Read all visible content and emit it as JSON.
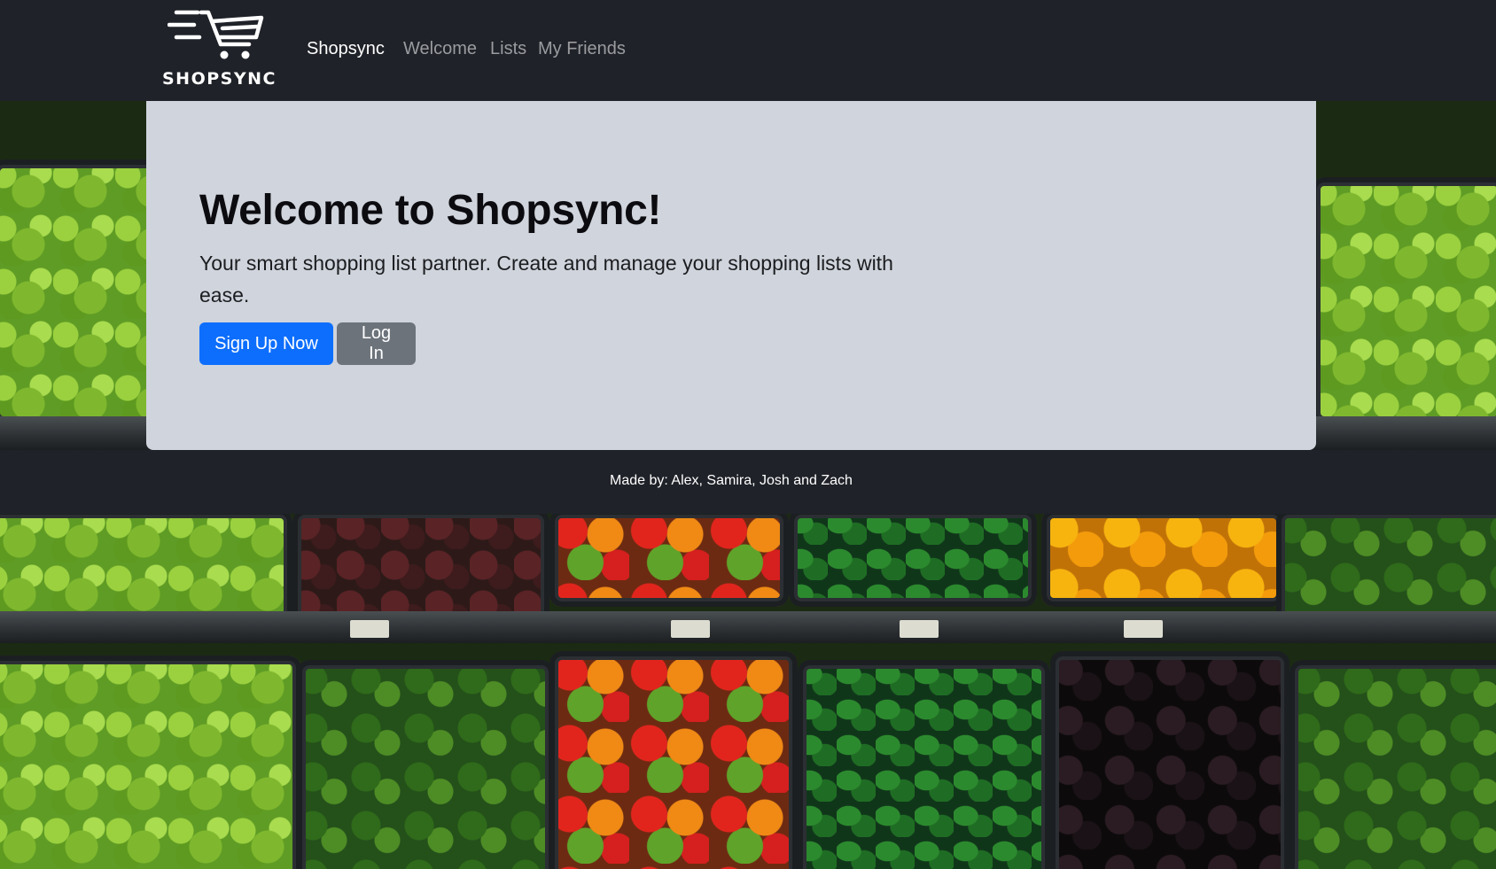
{
  "navbar": {
    "brand_name": "SHOPSYNC",
    "brand_link": "Shopsync",
    "links": [
      {
        "label": "Welcome"
      },
      {
        "label": "Lists"
      },
      {
        "label": "My Friends"
      }
    ]
  },
  "hero": {
    "title": "Welcome to Shopsync!",
    "lead": "Your smart shopping list partner. Create and manage your shopping lists with ease.",
    "primary_button": "Sign Up Now",
    "secondary_button": "Log In"
  },
  "footer": {
    "credits": "Made by: Alex, Samira, Josh and Zach"
  },
  "background": {
    "image": "produce-shelves-photo"
  },
  "colors": {
    "navbar_bg": "#1f2228",
    "hero_bg": "#d0d4dc",
    "primary": "#0d6efd",
    "secondary": "#6c737b",
    "nav_active": "#ffffff",
    "nav_muted": "#9a9ca0"
  }
}
